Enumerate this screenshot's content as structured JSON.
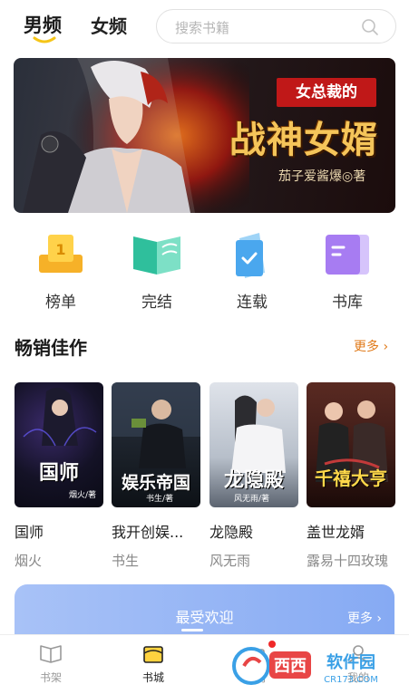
{
  "header": {
    "tab_male": "男频",
    "tab_female": "女频",
    "search_placeholder": "搜索书籍",
    "accent_color": "#f5c518"
  },
  "banner": {
    "subtitle": "女总裁的",
    "title": "战神女婿",
    "author": "茄子爱酱爆◎著"
  },
  "categories": [
    {
      "label": "榜单",
      "icon": "trophy-icon",
      "color": "#f6b128"
    },
    {
      "label": "完结",
      "icon": "book-open-icon",
      "color": "#33c9a5"
    },
    {
      "label": "连载",
      "icon": "document-check-icon",
      "color": "#5ab1f0"
    },
    {
      "label": "书库",
      "icon": "library-icon",
      "color": "#a77cf2"
    }
  ],
  "section": {
    "title": "畅销佳作",
    "more_label": "更多",
    "more_color": "#e07a1a"
  },
  "books": [
    {
      "cover_text": "国师",
      "cover_author": "烟火/著",
      "title": "国师",
      "author": "烟火"
    },
    {
      "cover_text": "娱乐帝国",
      "cover_author": "书生/著",
      "title": "我开创娱...",
      "author": "书生"
    },
    {
      "cover_text": "龙隐殿",
      "cover_author": "风无雨/著",
      "title": "龙隐殿",
      "author": "风无雨"
    },
    {
      "cover_text": "千禧大亨",
      "cover_author": "",
      "title": "盖世龙婿",
      "author": "露易十四玫瑰"
    }
  ],
  "favorites": {
    "title": "最受欢迎",
    "more_label": "更多"
  },
  "bottom_nav": [
    {
      "label": "书架",
      "icon": "bookshelf-icon",
      "active": false
    },
    {
      "label": "书城",
      "icon": "bookstore-icon",
      "active": true
    },
    {
      "label": "福利",
      "icon": "gift-icon",
      "active": false
    },
    {
      "label": "我的",
      "icon": "profile-icon",
      "active": false
    }
  ],
  "watermark": {
    "brand": "西西软件园",
    "site": "CR173.COM"
  }
}
